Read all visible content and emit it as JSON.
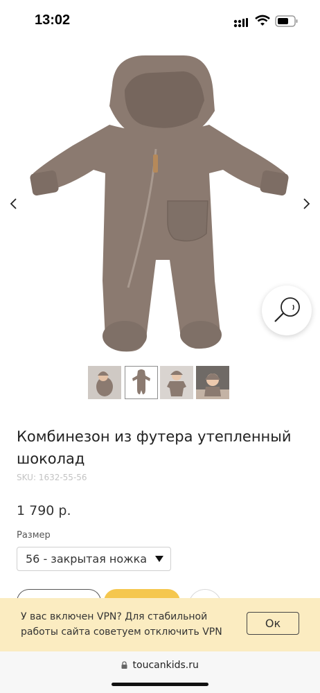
{
  "status_bar": {
    "time": "13:02"
  },
  "gallery": {
    "prev_icon": "chevron-left-icon",
    "next_icon": "chevron-right-icon",
    "zoom_icon": "magnifier-icon",
    "thumbnail_count": 4,
    "active_thumbnail": 2
  },
  "product": {
    "title": "Комбинезон из футера утепленный шоколад",
    "sku": "SKU: 1632-55-56",
    "price": "1 790 р."
  },
  "options": {
    "size_label": "Размер",
    "size_value": "56 - закрытая ножка"
  },
  "vpn_notice": {
    "text": "У вас включен VPN? Для стабильной работы сайта советуем отключить VPN",
    "ok_label": "Ок"
  },
  "browser": {
    "url": "toucankids.ru"
  },
  "colors": {
    "accent": "#f5c74e",
    "banner_bg": "#fbecc1",
    "garment": "#8b7a70"
  }
}
